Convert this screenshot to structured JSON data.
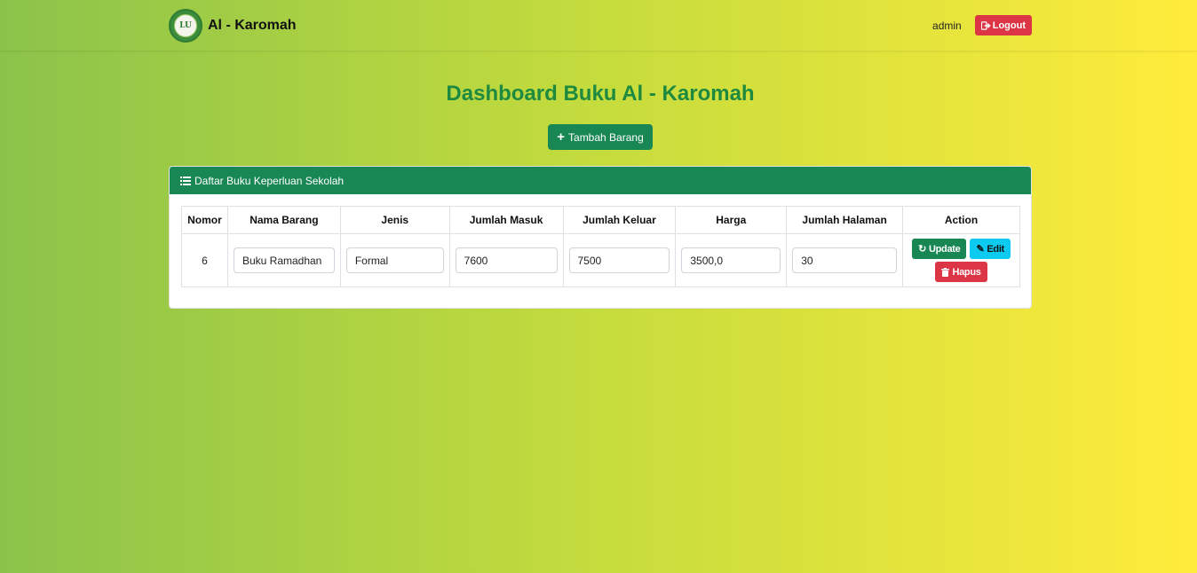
{
  "navbar": {
    "brand": "Al - Karomah",
    "logo_text": "LU",
    "user": "admin",
    "logout_label": "Logout"
  },
  "page": {
    "title": "Dashboard Buku Al - Karomah",
    "add_button": "Tambah Barang"
  },
  "card": {
    "header": "Daftar Buku Keperluan Sekolah"
  },
  "table": {
    "columns": [
      "Nomor",
      "Nama Barang",
      "Jenis",
      "Jumlah Masuk",
      "Jumlah Keluar",
      "Harga",
      "Jumlah Halaman",
      "Action"
    ],
    "rows": [
      {
        "nomor": "6",
        "nama_barang": "Buku Ramadhan",
        "jenis": "Formal",
        "jumlah_masuk": "7600",
        "jumlah_keluar": "7500",
        "harga": "3500,0",
        "jumlah_halaman": "30",
        "update_label": "Update",
        "edit_label": "Edit",
        "hapus_label": "Hapus"
      }
    ]
  },
  "colors": {
    "primary_green": "#198754",
    "danger": "#dc3545",
    "info": "#0dcaf0",
    "title_green": "#1e8a3f"
  }
}
